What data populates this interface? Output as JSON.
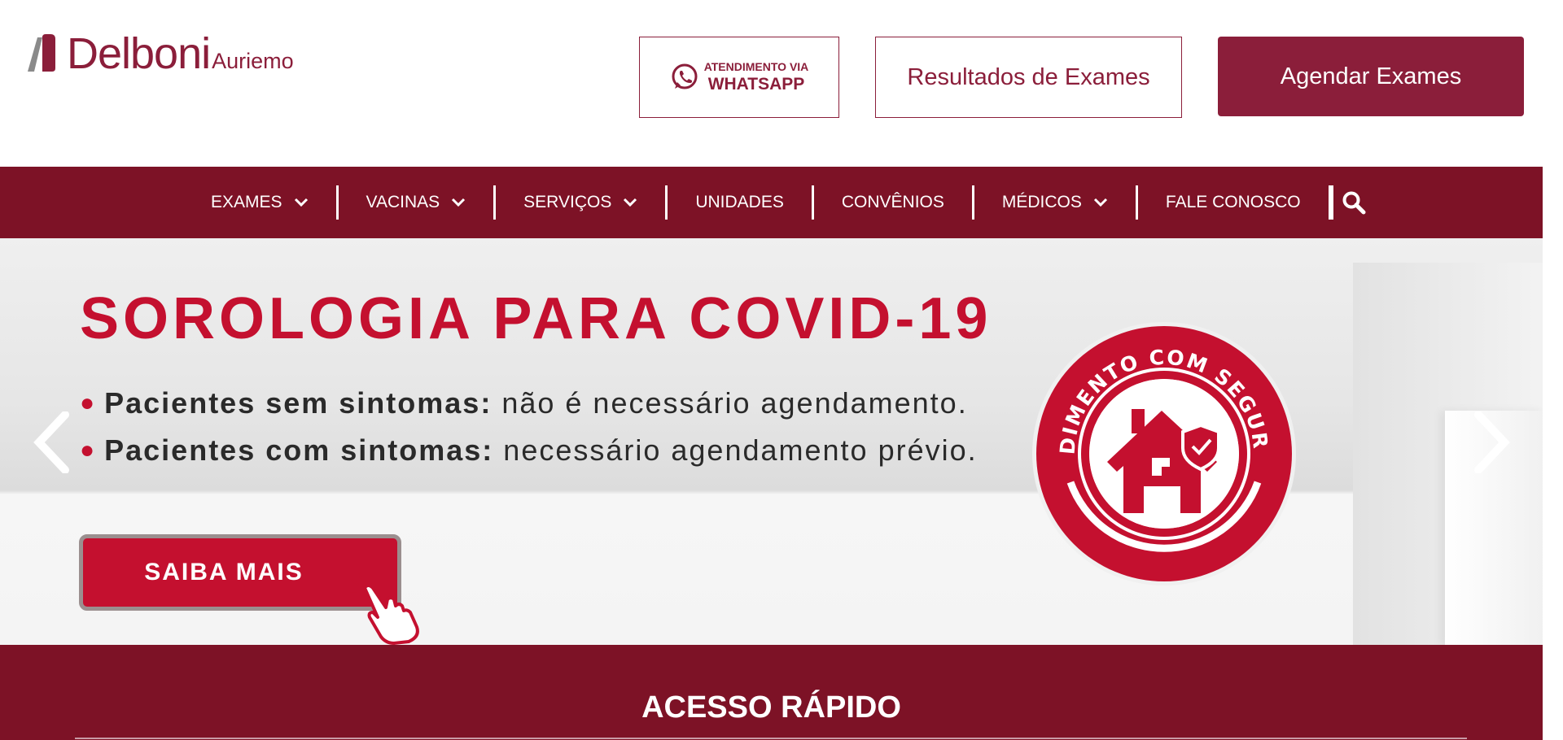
{
  "header": {
    "logo": {
      "brand": "Delboni",
      "sub": "Auriemo"
    },
    "whatsapp_button": {
      "line1": "ATENDIMENTO VIA",
      "line2": "WHATSAPP"
    },
    "results_button": "Resultados de Exames",
    "schedule_button": "Agendar Exames"
  },
  "nav": {
    "items": [
      {
        "label": "EXAMES",
        "dropdown": true
      },
      {
        "label": "VACINAS",
        "dropdown": true
      },
      {
        "label": "SERVIÇOS",
        "dropdown": true
      },
      {
        "label": "UNIDADES",
        "dropdown": false
      },
      {
        "label": "CONVÊNIOS",
        "dropdown": false
      },
      {
        "label": "MÉDICOS",
        "dropdown": true
      },
      {
        "label": "FALE CONOSCO",
        "dropdown": false
      }
    ],
    "search_icon": "search-icon"
  },
  "banner": {
    "title": "SOROLOGIA PARA COVID-19",
    "bullets": [
      {
        "strong": "Pacientes sem sintomas:",
        "rest": "não é necessário agendamento."
      },
      {
        "strong": "Pacientes com sintomas:",
        "rest": "necessário agendamento prévio."
      }
    ],
    "cta": "SAIBA MAIS",
    "seal_text": "ATENDIMENTO COM SEGURANÇA"
  },
  "quick_access": {
    "title": "ACESSO RÁPIDO"
  },
  "colors": {
    "brand": "#8b1e3a",
    "nav": "#7d1226",
    "banner_red": "#c4102f"
  }
}
